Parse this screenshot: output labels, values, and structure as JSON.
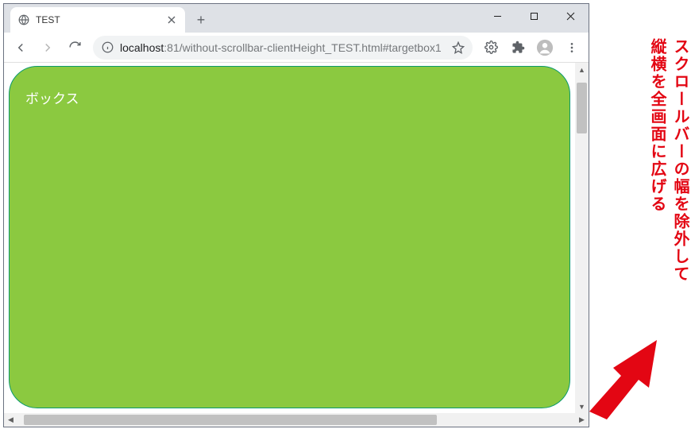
{
  "window": {
    "tab_title": "TEST"
  },
  "address": {
    "host": "localhost",
    "port": ":81",
    "path": "/without-scrollbar-clientHeight_TEST.html#targetbox1"
  },
  "content": {
    "box_label": "ボックス"
  },
  "annotation": {
    "line1": "スクロールバーの幅を除外して",
    "line2": "縦横を全画面に広げる"
  }
}
